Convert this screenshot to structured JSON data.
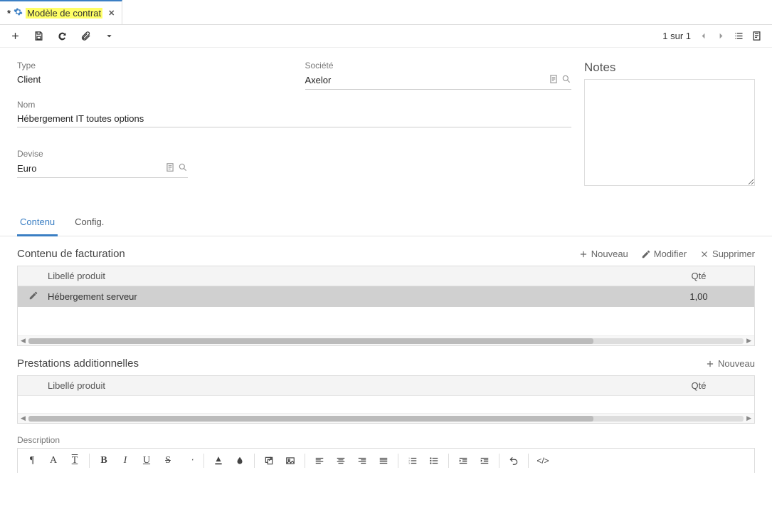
{
  "tab": {
    "dirty_marker": "*",
    "title": "Modèle de contrat"
  },
  "pager": {
    "text": "1 sur 1"
  },
  "fields": {
    "type_label": "Type",
    "type_value": "Client",
    "societe_label": "Société",
    "societe_value": "Axelor",
    "nom_label": "Nom",
    "nom_value": "Hébergement IT toutes options",
    "devise_label": "Devise",
    "devise_value": "Euro"
  },
  "notes": {
    "title": "Notes",
    "value": ""
  },
  "subtabs": {
    "contenu": "Contenu",
    "config": "Config."
  },
  "facturation": {
    "title": "Contenu de facturation",
    "new": "Nouveau",
    "edit": "Modifier",
    "delete": "Supprimer",
    "col_product": "Libellé produit",
    "col_qty": "Qté",
    "rows": [
      {
        "product": "Hébergement serveur",
        "qty": "1,00"
      }
    ]
  },
  "prestations": {
    "title": "Prestations additionnelles",
    "new": "Nouveau",
    "col_product": "Libellé produit",
    "col_qty": "Qté"
  },
  "description": {
    "label": "Description"
  }
}
